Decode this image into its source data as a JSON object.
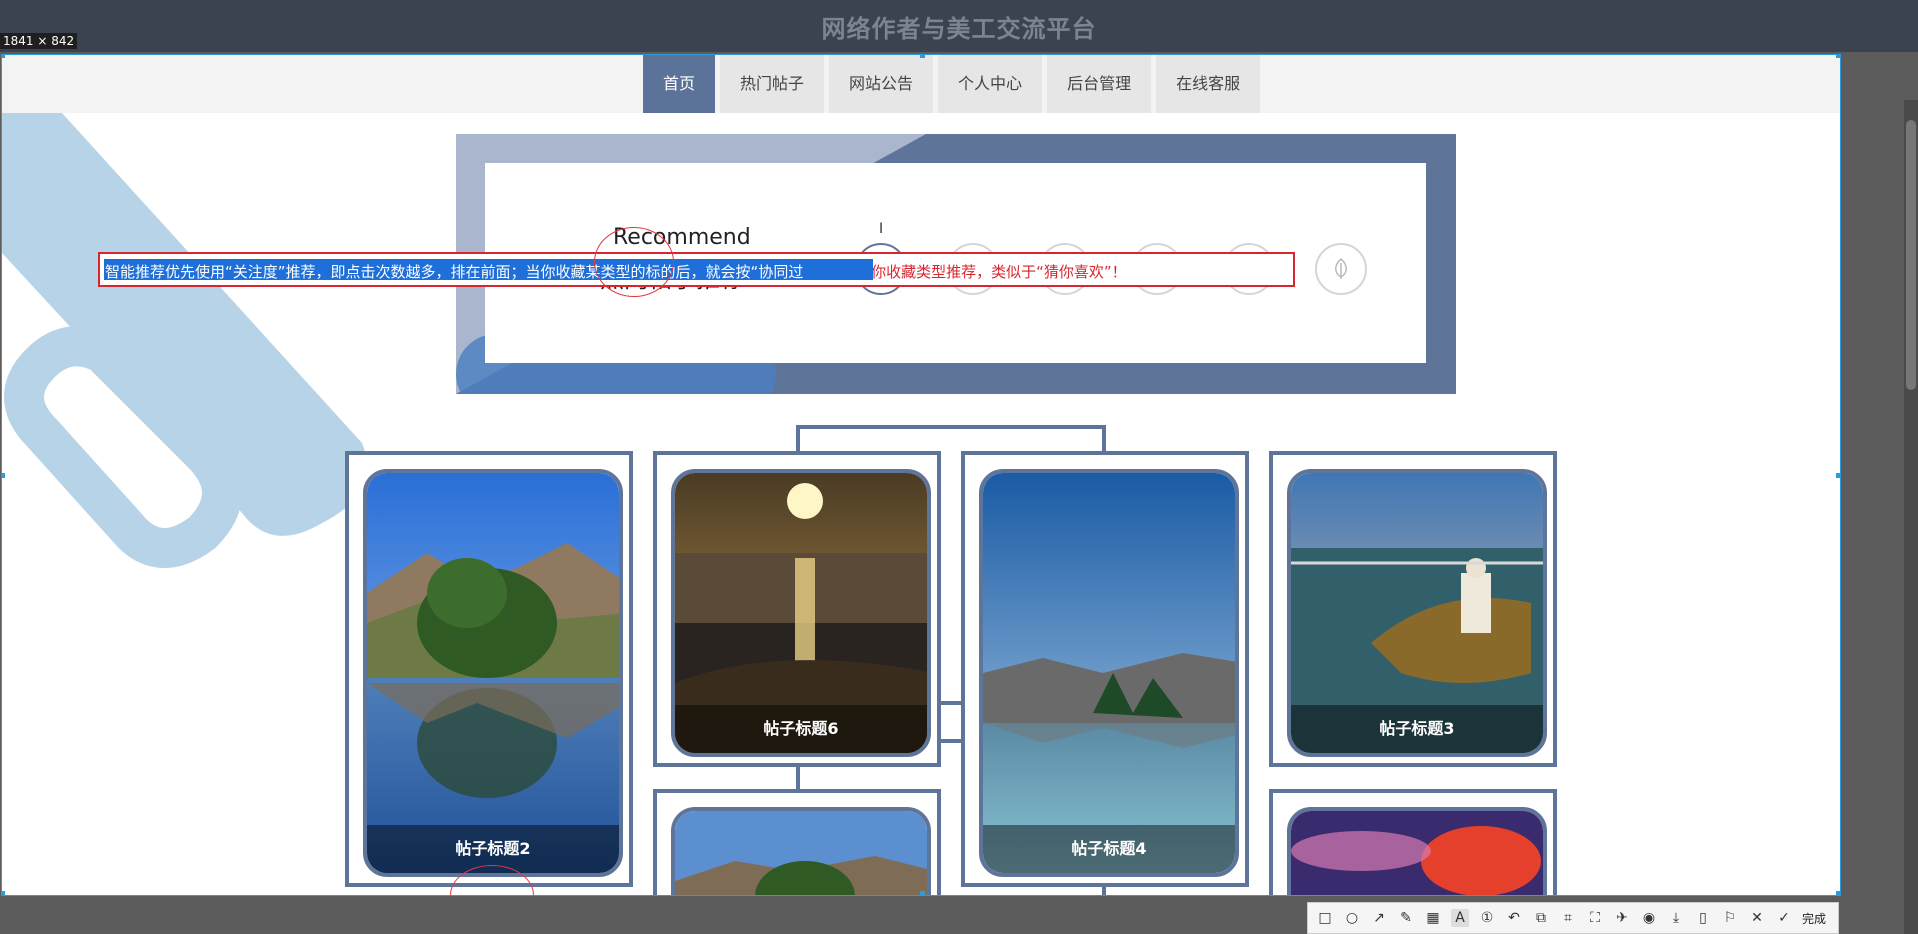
{
  "app_title": "网络作者与美工交流平台",
  "size_label": "1841 × 842",
  "nav": {
    "items": [
      {
        "label": "首页",
        "active": true
      },
      {
        "label": "热门帖子",
        "active": false
      },
      {
        "label": "网站公告",
        "active": false
      },
      {
        "label": "个人中心",
        "active": false
      },
      {
        "label": "后台管理",
        "active": false
      },
      {
        "label": "在线客服",
        "active": false
      }
    ]
  },
  "recommend": {
    "title_en": "Recommend",
    "title_cn": "热门帖子推荐"
  },
  "annotation": {
    "selected_text": "智能推荐优先使用“关注度”推荐，即点击次数越多，排在前面；当你收藏某类型的标的后，就会按“协同过",
    "full_text": "智能推荐优先使用“关注度”推荐，即点击次数越多，排在前面；当你收藏某类型的标的后，就会按“协同过滤”法，按你收藏类型推荐，类似于“猜你喜欢”！"
  },
  "cards": [
    {
      "caption": "帖子标题2"
    },
    {
      "caption": "帖子标题6"
    },
    {
      "caption": "帖子标题4"
    },
    {
      "caption": "帖子标题3"
    },
    {
      "caption": ""
    },
    {
      "caption": ""
    }
  ],
  "toolbar": {
    "tools": [
      "rectangle-icon",
      "ellipse-icon",
      "arrow-icon",
      "pen-icon",
      "mosaic-icon",
      "text-icon",
      "number-icon",
      "undo-icon",
      "ocr-icon",
      "translate-icon",
      "scan-icon",
      "pin-icon",
      "record-icon",
      "download-icon",
      "long-screenshot-icon",
      "bookmark-icon",
      "close-icon"
    ],
    "done_label": "完成"
  },
  "colors": {
    "accent": "#5e7599",
    "annotation_red": "#d9262e",
    "selection_blue": "#1e6fd9"
  }
}
